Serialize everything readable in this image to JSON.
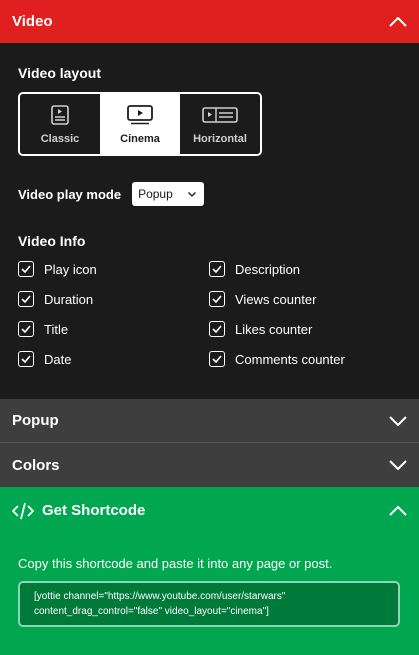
{
  "video": {
    "title": "Video",
    "layout_label": "Video layout",
    "layouts": [
      {
        "label": "Classic",
        "selected": false
      },
      {
        "label": "Cinema",
        "selected": true
      },
      {
        "label": "Horizontal",
        "selected": false
      }
    ],
    "play_mode_label": "Video play mode",
    "play_mode_value": "Popup",
    "info_label": "Video Info",
    "info_items": [
      {
        "label": "Play icon",
        "checked": true
      },
      {
        "label": "Description",
        "checked": true
      },
      {
        "label": "Duration",
        "checked": true
      },
      {
        "label": "Views counter",
        "checked": true
      },
      {
        "label": "Title",
        "checked": true
      },
      {
        "label": "Likes counter",
        "checked": true
      },
      {
        "label": "Date",
        "checked": true
      },
      {
        "label": "Comments counter",
        "checked": true
      }
    ]
  },
  "popup": {
    "title": "Popup"
  },
  "colors": {
    "title": "Colors"
  },
  "shortcode": {
    "title": "Get Shortcode",
    "instruction": "Copy this shortcode and paste it into any page or post.",
    "code": "[yottie channel=\"https://www.youtube.com/user/starwars\" content_drag_control=\"false\" video_layout=\"cinema\"]"
  },
  "colors_theme": {
    "video_header": "#e0201f",
    "collapsed_header": "#3e3e3e",
    "shortcode_green": "#00a650",
    "code_box_green": "#007a3b"
  }
}
